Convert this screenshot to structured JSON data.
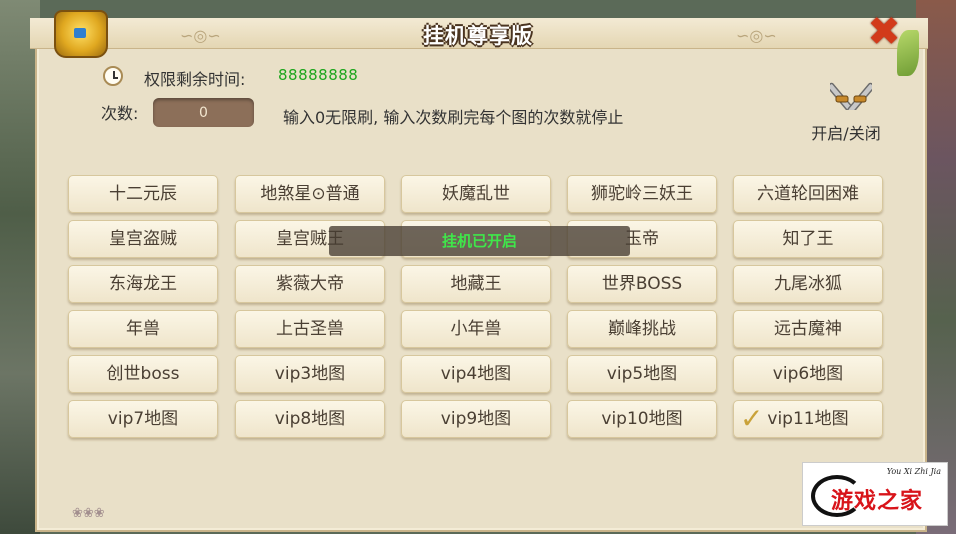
{
  "window": {
    "title": "挂机尊享版",
    "close_glyph": "✖"
  },
  "status": {
    "time_label": "权限剩余时间:",
    "time_value": "88888888",
    "count_label": "次数:",
    "count_value": "0",
    "hint": "输入0无限刷, 输入次数刷完每个图的次数就停止"
  },
  "toggle": {
    "label": "开启/关闭",
    "icon": "crossed-swords-icon"
  },
  "maps": [
    [
      "十二元辰",
      "地煞星⊙普通",
      "妖魔乱世",
      "狮驼岭三妖王",
      "六道轮回困难"
    ],
    [
      "皇宫盗贼",
      "皇宫贼王",
      "",
      "玉帝",
      "知了王"
    ],
    [
      "东海龙王",
      "紫薇大帝",
      "地藏王",
      "世界BOSS",
      "九尾冰狐"
    ],
    [
      "年兽",
      "上古圣兽",
      "小年兽",
      "巅峰挑战",
      "远古魔神"
    ],
    [
      "创世boss",
      "vip3地图",
      "vip4地图",
      "vip5地图",
      "vip6地图"
    ],
    [
      "vip7地图",
      "vip8地图",
      "vip9地图",
      "vip10地图",
      "vip11地图"
    ]
  ],
  "selected_map": "vip11地图",
  "toast": "挂机已开启",
  "watermark": {
    "text": "游戏之家",
    "sub": "You Xi Zhi Jia"
  },
  "colors": {
    "panel": "#e9e0c8",
    "time_value": "#1da51d",
    "toast_text": "#3fe64a",
    "close": "#d23a1a"
  }
}
